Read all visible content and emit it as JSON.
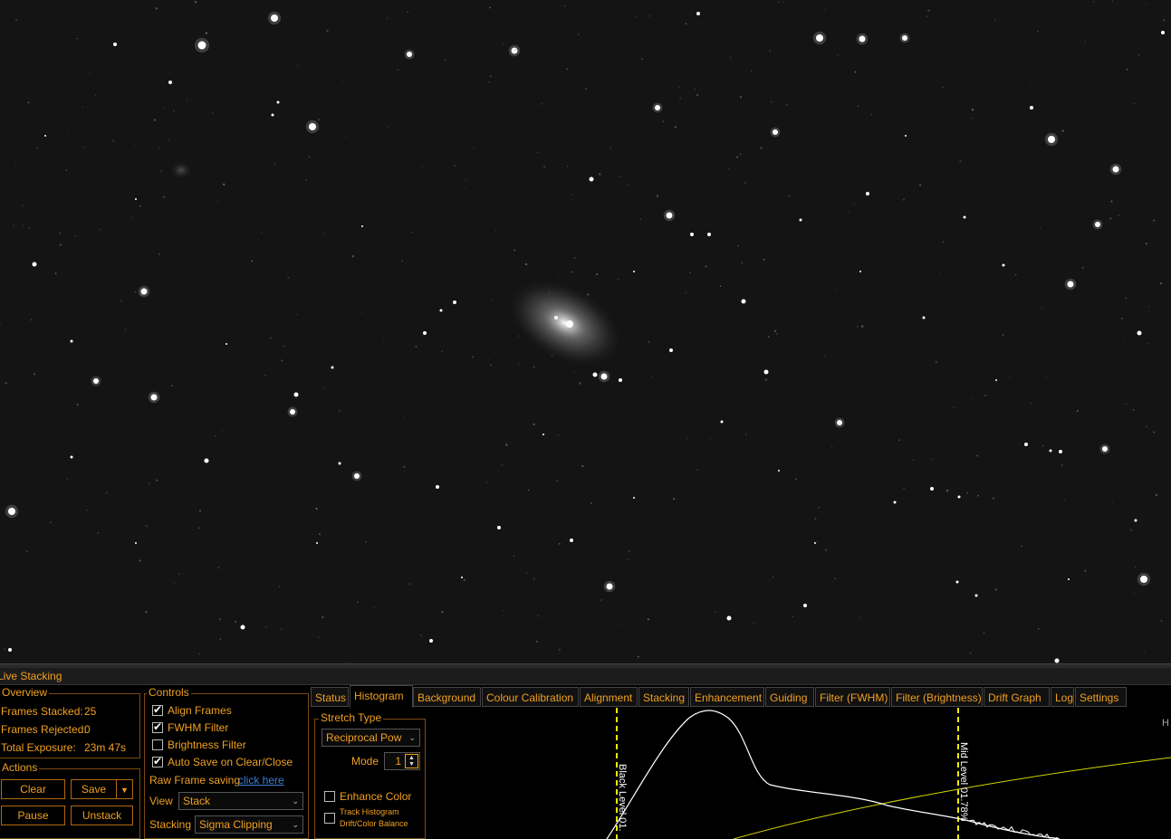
{
  "window": {
    "title": "Live Stacking"
  },
  "overview": {
    "title": "Overview",
    "frames_stacked_label": "Frames Stacked:",
    "frames_stacked_value": "25",
    "frames_rejected_label": "Frames Rejected:",
    "frames_rejected_value": "0",
    "total_exposure_label": "Total Exposure:",
    "total_exposure_value": "23m 47s"
  },
  "actions": {
    "title": "Actions",
    "clear": "Clear",
    "save": "Save",
    "pause": "Pause",
    "unstack": "Unstack"
  },
  "controls": {
    "title": "Controls",
    "align_frames": {
      "label": "Align Frames",
      "checked": true
    },
    "fwhm_filter": {
      "label": "FWHM Filter",
      "checked": true
    },
    "brightness_filter": {
      "label": "Brightness Filter",
      "checked": false
    },
    "auto_save": {
      "label": "Auto Save on Clear/Close",
      "checked": true
    },
    "raw_frame_label": "Raw Frame saving",
    "raw_frame_link": "click here",
    "view_label": "View",
    "view_value": "Stack",
    "stacking_label": "Stacking",
    "stacking_value": "Sigma Clipping"
  },
  "tabs": [
    "Status",
    "Histogram",
    "Background",
    "Colour Calibration",
    "Alignment",
    "Stacking",
    "Enhancement",
    "Guiding",
    "Filter (FWHM)",
    "Filter (Brightness)",
    "Drift Graph",
    "Log",
    "Settings"
  ],
  "active_tab": "Histogram",
  "histogram": {
    "stretch_title": "Stretch Type",
    "stretch_value": "Reciprocal Pow",
    "mode_label": "Mode",
    "mode_value": "1",
    "enhance_color": {
      "label": "Enhance Color",
      "checked": false
    },
    "track_histogram": {
      "label": "Track Histogram Drift/Color Balance",
      "label_line1": "Track Histogram",
      "label_line2": "Drift/Color Balance",
      "checked": false
    },
    "black_level_label": "Black Level 01.",
    "mid_level_label": "Mid Level 01.78%",
    "corner_label": "H"
  },
  "colors": {
    "accent": "#f0a020",
    "marker": "#f0f000",
    "curve": "#ffffff",
    "link": "#3a7ed8"
  }
}
